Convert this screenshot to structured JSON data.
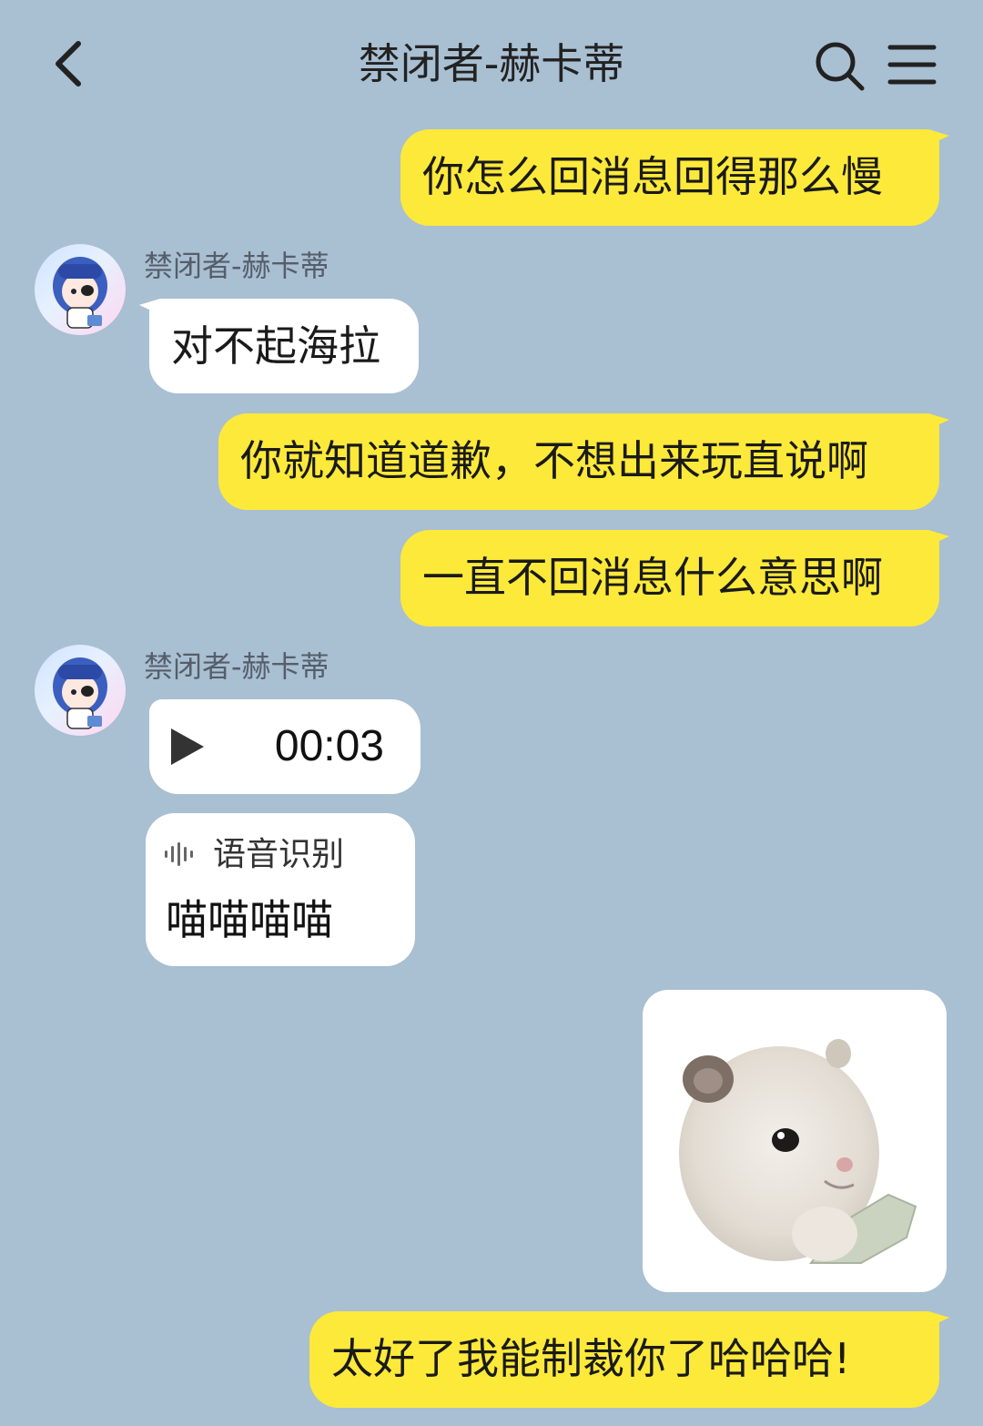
{
  "header": {
    "title": "禁闭者-赫卡蒂"
  },
  "messages": [
    {
      "from": "me",
      "text": "你怎么回消息回得那么慢"
    },
    {
      "from": "them",
      "sender": "禁闭者-赫卡蒂",
      "text": "对不起海拉"
    },
    {
      "from": "me",
      "text": "你就知道道歉，不想出来玩直说啊"
    },
    {
      "from": "me",
      "text": "一直不回消息什么意思啊"
    },
    {
      "from": "them",
      "sender": "禁闭者-赫卡蒂",
      "voice_duration": "00:03",
      "asr_label": "语音识别",
      "asr_text": "喵喵喵喵"
    },
    {
      "from": "me",
      "type": "sticker",
      "sticker": "hamster-sticker"
    },
    {
      "from": "me",
      "text": "太好了我能制裁你了哈哈哈!"
    }
  ],
  "colors": {
    "background": "#a9bfd2",
    "my_bubble": "#fde93a",
    "their_bubble": "#ffffff"
  },
  "icons": [
    "back-arrow-icon",
    "search-icon",
    "menu-icon",
    "play-icon",
    "voice-wave-icon"
  ]
}
